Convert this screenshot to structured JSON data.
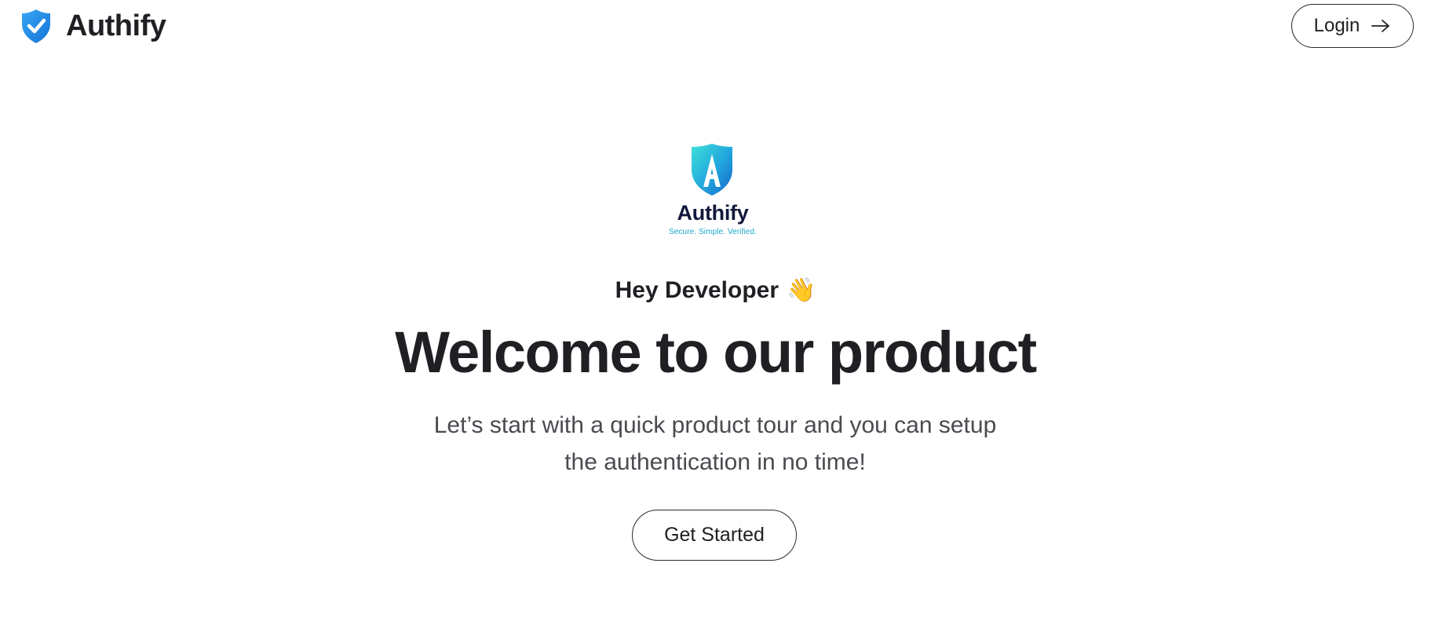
{
  "navbar": {
    "brand_name": "Authify",
    "brand_icon": "shield-check-icon",
    "login_label": "Login",
    "login_icon": "arrow-right-icon"
  },
  "hero": {
    "logo": {
      "name": "Authify",
      "tagline": "Secure. Simple. Verified.",
      "icon": "shield-a-icon"
    },
    "greeting": "Hey Developer",
    "greeting_emoji": "👋",
    "headline": "Welcome to our product",
    "subtitle_line1": "Let’s start with a quick product tour and you can setup",
    "subtitle_line2": "the authentication in no time!",
    "cta_label": "Get Started"
  },
  "colors": {
    "brand_blue": "#1e8be6",
    "logo_teal": "#2fd0d6",
    "logo_navy": "#11183a",
    "tagline_teal": "#1aa8c7",
    "text_dark": "#1f1f24",
    "text_muted": "#4a4a50"
  }
}
